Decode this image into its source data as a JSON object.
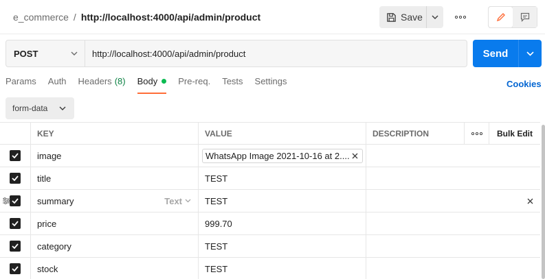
{
  "header": {
    "collection": "e_commerce",
    "separator": "/",
    "request_name": "http://localhost:4000/api/admin/product",
    "save_label": "Save"
  },
  "request": {
    "method": "POST",
    "url": "http://localhost:4000/api/admin/product",
    "send_label": "Send"
  },
  "tabs": [
    {
      "label": "Params"
    },
    {
      "label": "Auth"
    },
    {
      "label": "Headers",
      "count": "(8)"
    },
    {
      "label": "Body"
    },
    {
      "label": "Pre-req."
    },
    {
      "label": "Tests"
    },
    {
      "label": "Settings"
    }
  ],
  "cookies_label": "Cookies",
  "body_type": "form-data",
  "table": {
    "headers": {
      "key": "KEY",
      "value": "VALUE",
      "description": "DESCRIPTION",
      "bulk_edit": "Bulk Edit"
    },
    "rows": [
      {
        "key": "image",
        "value": "WhatsApp Image 2021-10-16 at 2....",
        "checked": true
      },
      {
        "key": "title",
        "value": "TEST",
        "checked": true
      },
      {
        "key": "summary",
        "value": "TEST",
        "type": "Text",
        "checked": true
      },
      {
        "key": "price",
        "value": "999.70",
        "checked": true
      },
      {
        "key": "category",
        "value": "TEST",
        "checked": true
      },
      {
        "key": "stock",
        "value": "TEST",
        "checked": true
      }
    ]
  },
  "colors": {
    "send_blue": "#097bed",
    "active_tab_underline": "#ff6c37",
    "body_dot": "#0cbb52",
    "cookies_link": "#0265d2"
  }
}
